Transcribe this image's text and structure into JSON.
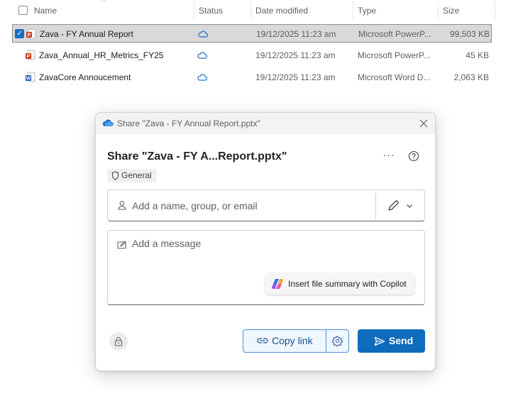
{
  "explorer": {
    "columns": {
      "name": "Name",
      "status": "Status",
      "date_modified": "Date modified",
      "type": "Type",
      "size": "Size"
    },
    "files": [
      {
        "name": "Zava - FY Annual Report",
        "status_icon": "cloud-icon",
        "date_modified": "19/12/2025 11:23 am",
        "type": "Microsoft PowerP...",
        "size": "99,503 KB",
        "selected": true,
        "file_icon": "powerpoint-file-icon"
      },
      {
        "name": "Zava_Annual_HR_Metrics_FY25",
        "status_icon": "cloud-icon",
        "date_modified": "19/12/2025 11:23 am",
        "type": "Microsoft PowerP...",
        "size": "45 KB",
        "selected": false,
        "file_icon": "powerpoint-file-icon"
      },
      {
        "name": "ZavaCore Annoucement",
        "status_icon": "cloud-icon",
        "date_modified": "19/12/2025 11:23 am",
        "type": "Microsoft Word D...",
        "size": "2,063 KB",
        "selected": false,
        "file_icon": "word-file-icon"
      }
    ]
  },
  "share_dialog": {
    "window_title": "Share \"Zava - FY Annual Report.pptx\"",
    "heading": "Share \"Zava - FY A...Report.pptx\"",
    "more_label": "···",
    "sensitivity_label": "General",
    "recipients_placeholder": "Add a name, group, or email",
    "message_placeholder": "Add a message",
    "copilot_button": "Insert file summary with Copilot",
    "copy_link_button": "Copy link",
    "send_button": "Send"
  },
  "colors": {
    "accent": "#0f6cbd",
    "selection_bg": "#d9d9d9",
    "cloud_status": "#1a6fc4",
    "powerpoint": "#c43e1c",
    "word": "#185abd"
  }
}
